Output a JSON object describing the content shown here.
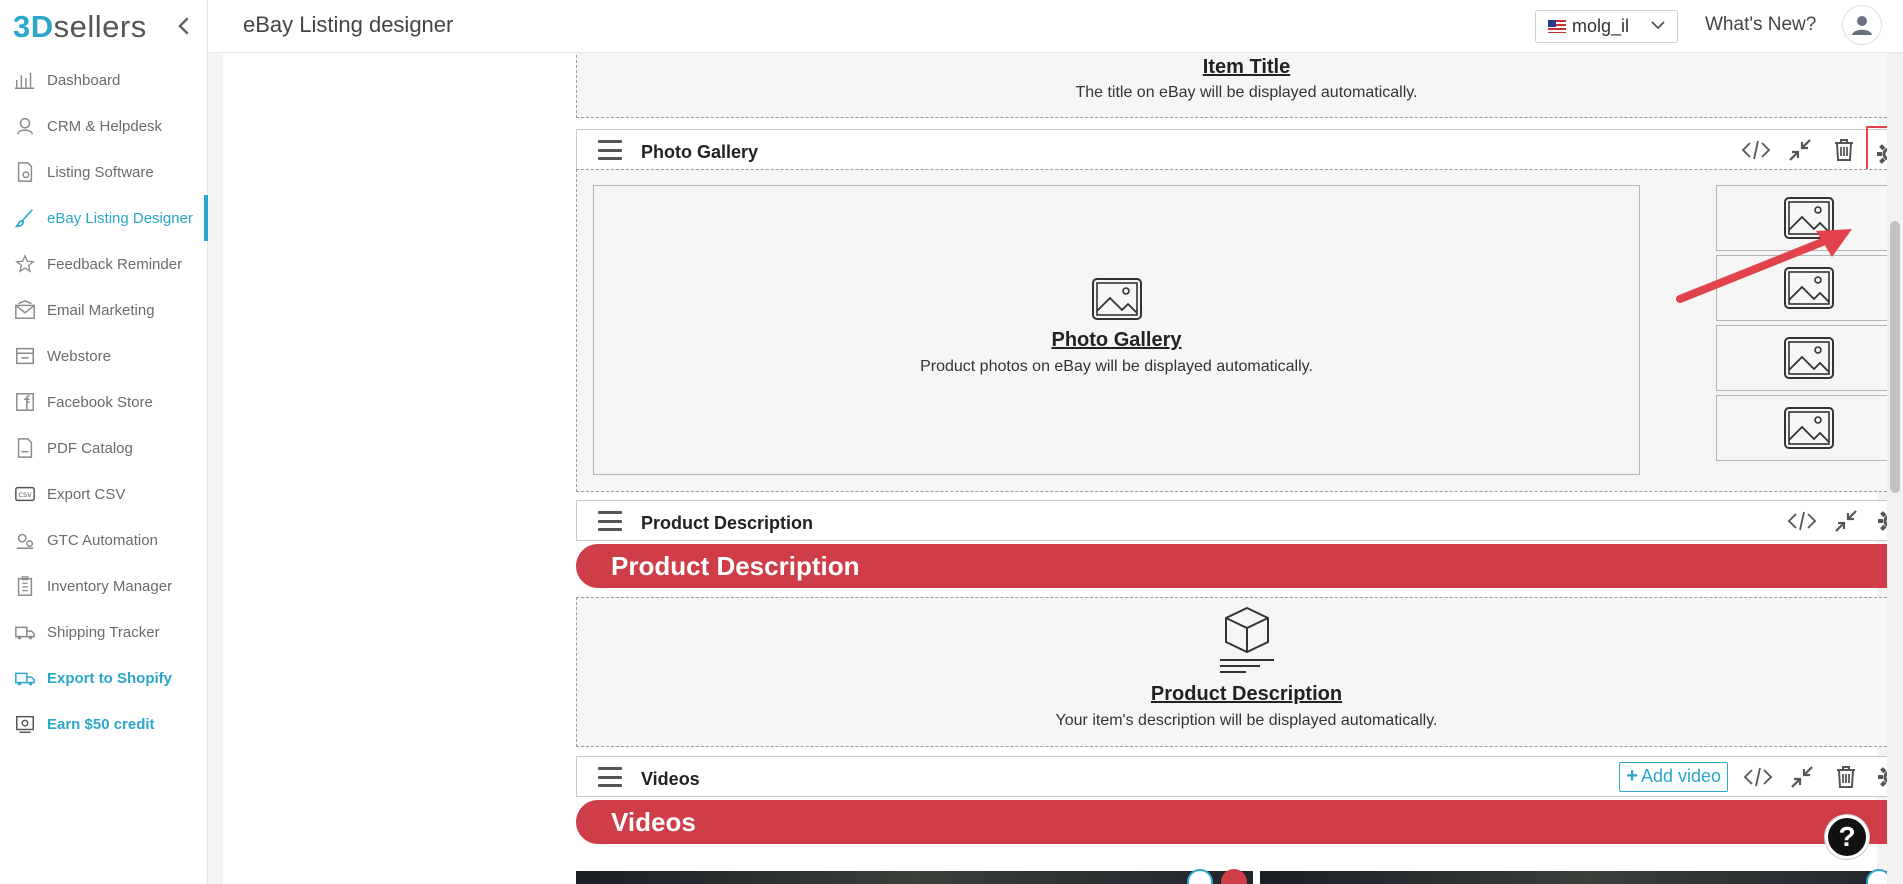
{
  "brand": {
    "num": "3D",
    "rest": "sellers"
  },
  "sidebar": {
    "items": [
      {
        "label": "Dashboard",
        "icon": "bar-chart-icon"
      },
      {
        "label": "CRM & Helpdesk",
        "icon": "headset-icon"
      },
      {
        "label": "Listing Software",
        "icon": "document-gear-icon"
      },
      {
        "label": "eBay Listing Designer",
        "icon": "paintbrush-icon",
        "active": true
      },
      {
        "label": "Feedback Reminder",
        "icon": "star-icon"
      },
      {
        "label": "Email Marketing",
        "icon": "envelope-icon"
      },
      {
        "label": "Webstore",
        "icon": "store-icon"
      },
      {
        "label": "Facebook Store",
        "icon": "facebook-store-icon"
      },
      {
        "label": "PDF Catalog",
        "icon": "pdf-icon"
      },
      {
        "label": "Export CSV",
        "icon": "csv-icon"
      },
      {
        "label": "GTC Automation",
        "icon": "automation-icon"
      },
      {
        "label": "Inventory Manager",
        "icon": "clipboard-icon"
      },
      {
        "label": "Shipping Tracker",
        "icon": "truck-icon"
      },
      {
        "label": "Export to Shopify",
        "icon": "shopify-icon"
      },
      {
        "label": "Earn $50 credit",
        "icon": "gift-icon"
      }
    ]
  },
  "header": {
    "title": "eBay Listing designer",
    "account": "molg_il",
    "whats_new": "What's New?"
  },
  "blocks": {
    "item_title": {
      "heading": "Item Title",
      "text": "The title on eBay will be displayed automatically."
    },
    "photo_gallery": {
      "bar_title": "Photo Gallery",
      "heading": "Photo Gallery",
      "text": "Product photos on eBay will be displayed automatically."
    },
    "product_description": {
      "bar_title": "Product Description",
      "banner": "Product Description",
      "heading": "Product Description",
      "text": "Your item's description will be displayed automatically."
    },
    "videos": {
      "bar_title": "Videos",
      "banner": "Videos",
      "add_video": "Add video"
    }
  },
  "colors": {
    "accent": "#2aa7c9",
    "banner": "#ce3d48",
    "highlight": "#e2424b"
  },
  "help": "?"
}
